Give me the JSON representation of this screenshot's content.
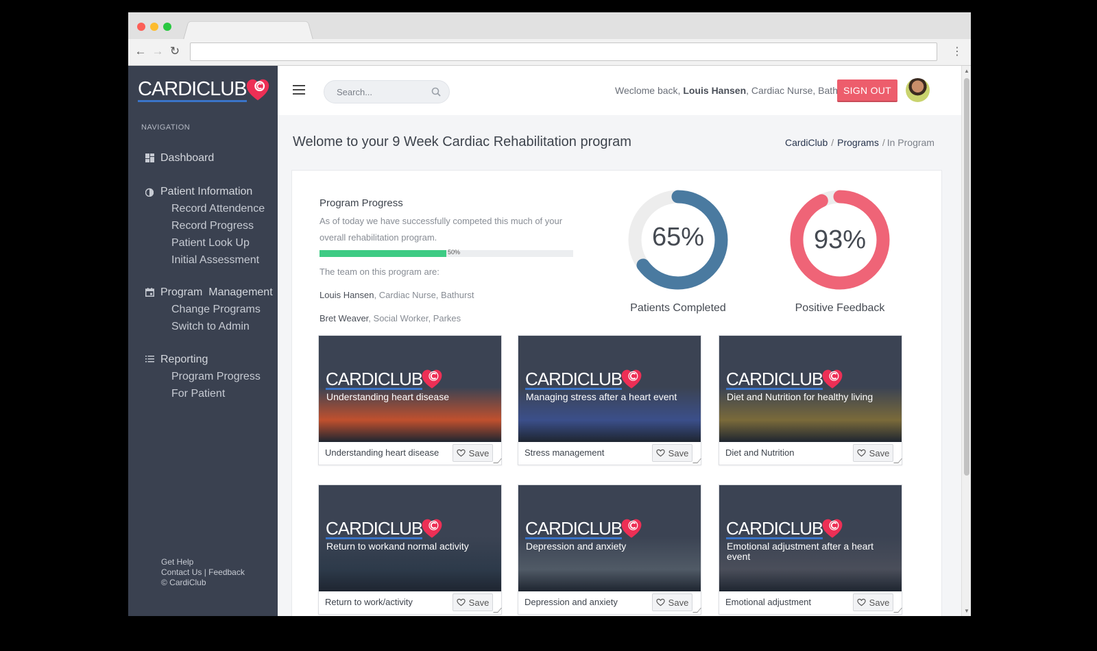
{
  "app": {
    "brand": "CARDICLUB",
    "brand_color": "#ed2f55",
    "accent_color": "#3ecb84",
    "sidebar_bg": "#3a4150"
  },
  "sidebar": {
    "nav_title": "NAVIGATION",
    "dashboard": {
      "label": "Dashboard",
      "icon": "dashboard-icon"
    },
    "patient_info": {
      "label": "Patient Information",
      "icon": "drop-icon",
      "items": [
        "Record Attendence",
        "Record Progress",
        "Patient Look Up",
        "Initial Assessment"
      ]
    },
    "program_mgmt": {
      "label": "Program  Management",
      "icon": "calendar-icon",
      "items": [
        "Change Programs",
        "Switch to Admin"
      ]
    },
    "reporting": {
      "label": "Reporting",
      "icon": "list-icon",
      "items": [
        "Program Progress",
        "For Patient"
      ]
    },
    "footer": {
      "help": "Get Help",
      "contact": "Contact Us | Feedback",
      "copyright": "© CardiClub"
    }
  },
  "header": {
    "search_placeholder": "Search...",
    "welcome_prefix": "Weclome back,",
    "user_name": "Louis Hansen",
    "user_role": ", Cardiac Nurse, Bathurst",
    "signout_label": "SIGN OUT"
  },
  "page": {
    "title": "Welome to your 9 Week Cardiac Rehabilitation program",
    "breadcrumb": [
      "CardiClub",
      "Programs",
      "In Program"
    ]
  },
  "progress": {
    "title": "Program Progress",
    "description": "As of today we have successfully competed this much of your overall rehabilitation program.",
    "percent_label": "50%",
    "percent_value": 0.5,
    "team_title": "The team on this program are:",
    "team": [
      {
        "name": "Louis Hansen",
        "detail": ", Cardiac Nurse, Bathurst"
      },
      {
        "name": "Bret Weaver",
        "detail": ", Social Worker, Parkes"
      }
    ]
  },
  "stats": [
    {
      "value_label": "65%",
      "value": 0.65,
      "label": "Patients Completed",
      "color": "#4a7aa0"
    },
    {
      "value_label": "93%",
      "value": 0.93,
      "label": "Positive Feedback",
      "color": "#ef6477"
    }
  ],
  "tiles": [
    {
      "subtitle": "Understanding heart disease",
      "caption": "Understanding heart disease",
      "save": "Save",
      "photo_tone": "#c0502e"
    },
    {
      "subtitle": "Managing stress after a heart event",
      "caption": "Stress management",
      "save": "Save",
      "photo_tone": "#3b4f8a"
    },
    {
      "subtitle": "Diet and Nutrition for healthy living",
      "caption": "Diet and Nutrition",
      "save": "Save",
      "photo_tone": "#7a6a3a"
    },
    {
      "subtitle": "Return to workand normal activity",
      "caption": "Return to work/activity",
      "save": "Save",
      "photo_tone": "#2d3a4a"
    },
    {
      "subtitle": "Depression and anxiety",
      "caption": "Depression and anxiety",
      "save": "Save",
      "photo_tone": "#505a66"
    },
    {
      "subtitle": "Emotional adjustment after a heart event",
      "caption": "Emotional adjustment",
      "save": "Save",
      "photo_tone": "#4a4e5a"
    }
  ]
}
